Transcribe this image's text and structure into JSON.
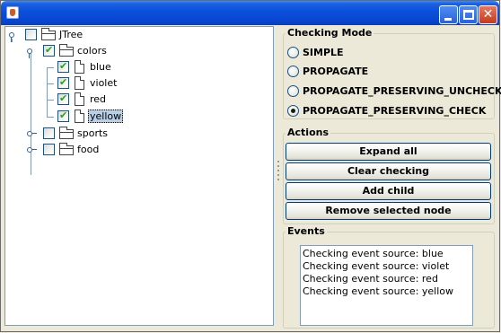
{
  "window": {
    "buttons": [
      "minimize",
      "maximize",
      "close"
    ]
  },
  "tree": {
    "root": {
      "label": "JTree",
      "checked": false,
      "expanded": true
    },
    "nodes": [
      {
        "label": "colors",
        "checked": true,
        "expanded": true,
        "type": "folder"
      },
      {
        "label": "blue",
        "checked": true,
        "type": "leaf"
      },
      {
        "label": "violet",
        "checked": true,
        "type": "leaf"
      },
      {
        "label": "red",
        "checked": true,
        "type": "leaf"
      },
      {
        "label": "yellow",
        "checked": true,
        "type": "leaf",
        "selected": true
      },
      {
        "label": "sports",
        "checked": false,
        "expanded": false,
        "type": "folder"
      },
      {
        "label": "food",
        "checked": false,
        "expanded": false,
        "type": "folder"
      }
    ]
  },
  "checking_mode": {
    "title": "Checking Mode",
    "options": [
      "SIMPLE",
      "PROPAGATE",
      "PROPAGATE_PRESERVING_UNCHECK",
      "PROPAGATE_PRESERVING_CHECK"
    ],
    "selected": "PROPAGATE_PRESERVING_CHECK"
  },
  "actions": {
    "title": "Actions",
    "buttons": [
      "Expand all",
      "Clear checking",
      "Add child",
      "Remove selected node"
    ]
  },
  "events": {
    "title": "Events",
    "lines": [
      "Checking event source: blue",
      "Checking event source: violet",
      "Checking event source: red",
      "Checking event source: yellow"
    ]
  },
  "colors": {
    "titlebar": "#0a4fdc",
    "window_bg": "#ece9d8",
    "tree_bg": "#ffffff",
    "selection_bg": "#b8cfe5",
    "check_mark": "#21a121"
  }
}
